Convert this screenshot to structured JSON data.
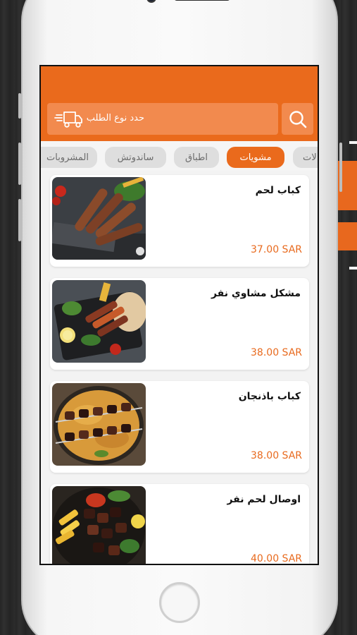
{
  "app": {
    "search": {
      "placeholder": "حدد نوع الطلب"
    },
    "categories": [
      {
        "label": "لات"
      },
      {
        "label": "مشويات"
      },
      {
        "label": "اطباق"
      },
      {
        "label": "ساندوتش"
      },
      {
        "label": "المشروبات"
      }
    ],
    "active_category": "مشويات",
    "menu_items": [
      {
        "name": "كباب لحم",
        "price": "37.00 SAR",
        "photo": "kebab-skewers-photo"
      },
      {
        "name": "مشكل مشاوي نفر",
        "price": "38.00 SAR",
        "photo": "mixed-grill-photo"
      },
      {
        "name": "كباب باذنجان",
        "price": "38.00 SAR",
        "photo": "eggplant-kebab-photo"
      },
      {
        "name": "اوصال لحم نفر",
        "price": "40.00 SAR",
        "photo": "meat-cubes-photo"
      }
    ],
    "colors": {
      "accent": "#ea6a1c",
      "search_bg": "#f28a4e",
      "price": "#e86a1e",
      "tab_inactive": "#dedede"
    },
    "icons": [
      "search-icon",
      "delivery-truck-icon"
    ]
  }
}
